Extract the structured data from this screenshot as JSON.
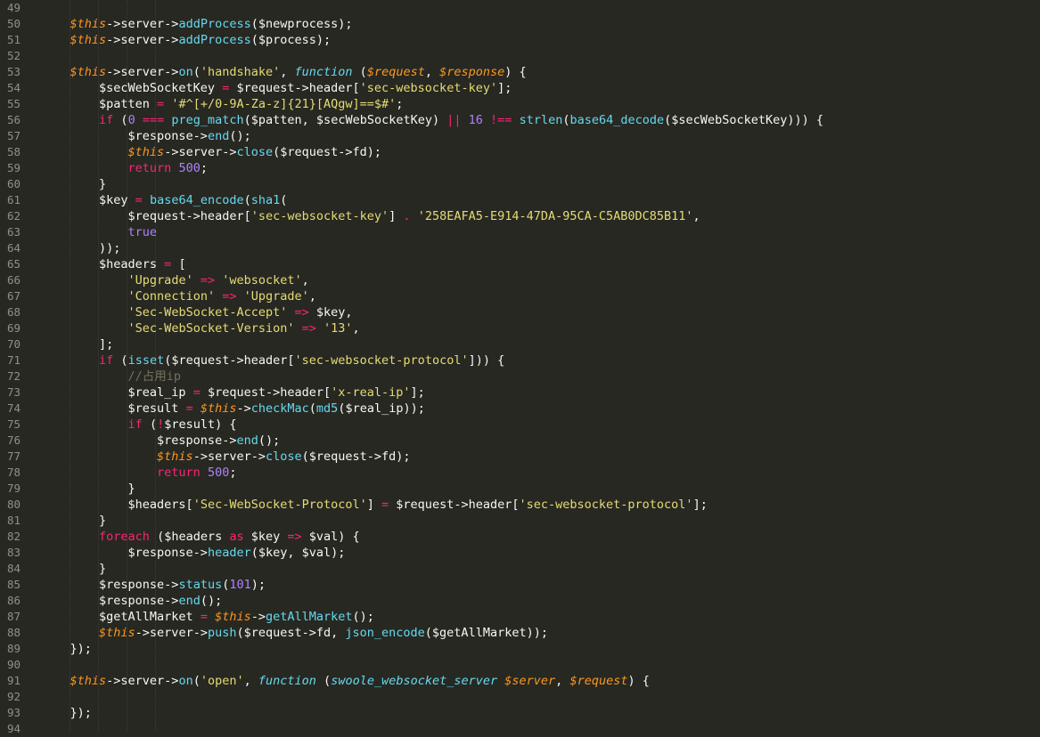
{
  "editor": {
    "theme_colors": {
      "background": "#272822",
      "text": "#f8f8f2",
      "line_number": "#90908a",
      "variable_this": "#fd971f",
      "function": "#66d9ef",
      "keyword": "#f92672",
      "string": "#e6db74",
      "number": "#ae81ff",
      "comment": "#75715e"
    },
    "lines": [
      {
        "n": "49",
        "tokens": []
      },
      {
        "n": "50",
        "tokens": [
          [
            "    ",
            "v"
          ],
          [
            "$this",
            "t"
          ],
          [
            "->server->",
            "v"
          ],
          [
            "addProcess",
            "f"
          ],
          [
            "($newprocess);",
            "v"
          ]
        ]
      },
      {
        "n": "51",
        "tokens": [
          [
            "    ",
            "v"
          ],
          [
            "$this",
            "t"
          ],
          [
            "->server->",
            "v"
          ],
          [
            "addProcess",
            "f"
          ],
          [
            "($process);",
            "v"
          ]
        ]
      },
      {
        "n": "52",
        "tokens": []
      },
      {
        "n": "53",
        "tokens": [
          [
            "    ",
            "v"
          ],
          [
            "$this",
            "t"
          ],
          [
            "->server->",
            "v"
          ],
          [
            "on",
            "f"
          ],
          [
            "(",
            "v"
          ],
          [
            "'handshake'",
            "s"
          ],
          [
            ", ",
            "v"
          ],
          [
            "function",
            "it"
          ],
          [
            " (",
            "v"
          ],
          [
            "$request",
            "t"
          ],
          [
            ", ",
            "v"
          ],
          [
            "$response",
            "t"
          ],
          [
            ") {",
            "v"
          ]
        ]
      },
      {
        "n": "54",
        "tokens": [
          [
            "        $secWebSocketKey ",
            "v"
          ],
          [
            "=",
            "k"
          ],
          [
            " $request->header[",
            "v"
          ],
          [
            "'sec-websocket-key'",
            "s"
          ],
          [
            "];",
            "v"
          ]
        ]
      },
      {
        "n": "55",
        "tokens": [
          [
            "        $patten ",
            "v"
          ],
          [
            "=",
            "k"
          ],
          [
            " ",
            "v"
          ],
          [
            "'#^[+/0-9A-Za-z]{21}[AQgw]==$#'",
            "s"
          ],
          [
            ";",
            "v"
          ]
        ]
      },
      {
        "n": "56",
        "tokens": [
          [
            "        ",
            "v"
          ],
          [
            "if",
            "k"
          ],
          [
            " (",
            "v"
          ],
          [
            "0",
            "n"
          ],
          [
            " ",
            "v"
          ],
          [
            "===",
            "k"
          ],
          [
            " ",
            "v"
          ],
          [
            "preg_match",
            "f"
          ],
          [
            "($patten, $secWebSocketKey) ",
            "v"
          ],
          [
            "||",
            "k"
          ],
          [
            " ",
            "v"
          ],
          [
            "16",
            "n"
          ],
          [
            " ",
            "v"
          ],
          [
            "!==",
            "k"
          ],
          [
            " ",
            "v"
          ],
          [
            "strlen",
            "f"
          ],
          [
            "(",
            "v"
          ],
          [
            "base64_decode",
            "f"
          ],
          [
            "($secWebSocketKey))) {",
            "v"
          ]
        ]
      },
      {
        "n": "57",
        "tokens": [
          [
            "            $response->",
            "v"
          ],
          [
            "end",
            "f"
          ],
          [
            "();",
            "v"
          ]
        ]
      },
      {
        "n": "58",
        "tokens": [
          [
            "            ",
            "v"
          ],
          [
            "$this",
            "t"
          ],
          [
            "->server->",
            "v"
          ],
          [
            "close",
            "f"
          ],
          [
            "($request->fd);",
            "v"
          ]
        ]
      },
      {
        "n": "59",
        "tokens": [
          [
            "            ",
            "v"
          ],
          [
            "return",
            "k"
          ],
          [
            " ",
            "v"
          ],
          [
            "500",
            "n"
          ],
          [
            ";",
            "v"
          ]
        ]
      },
      {
        "n": "60",
        "tokens": [
          [
            "        }",
            "v"
          ]
        ]
      },
      {
        "n": "61",
        "tokens": [
          [
            "        $key ",
            "v"
          ],
          [
            "=",
            "k"
          ],
          [
            " ",
            "v"
          ],
          [
            "base64_encode",
            "f"
          ],
          [
            "(",
            "v"
          ],
          [
            "sha1",
            "f"
          ],
          [
            "(",
            "v"
          ]
        ]
      },
      {
        "n": "62",
        "tokens": [
          [
            "            $request->header[",
            "v"
          ],
          [
            "'sec-websocket-key'",
            "s"
          ],
          [
            "] ",
            "v"
          ],
          [
            ".",
            "k"
          ],
          [
            " ",
            "v"
          ],
          [
            "'258EAFA5-E914-47DA-95CA-C5AB0DC85B11'",
            "s"
          ],
          [
            ",",
            "v"
          ]
        ]
      },
      {
        "n": "63",
        "tokens": [
          [
            "            ",
            "v"
          ],
          [
            "true",
            "n"
          ]
        ]
      },
      {
        "n": "64",
        "tokens": [
          [
            "        ));",
            "v"
          ]
        ]
      },
      {
        "n": "65",
        "tokens": [
          [
            "        $headers ",
            "v"
          ],
          [
            "=",
            "k"
          ],
          [
            " [",
            "v"
          ]
        ]
      },
      {
        "n": "66",
        "tokens": [
          [
            "            ",
            "v"
          ],
          [
            "'Upgrade'",
            "s"
          ],
          [
            " ",
            "v"
          ],
          [
            "=>",
            "k"
          ],
          [
            " ",
            "v"
          ],
          [
            "'websocket'",
            "s"
          ],
          [
            ",",
            "v"
          ]
        ]
      },
      {
        "n": "67",
        "tokens": [
          [
            "            ",
            "v"
          ],
          [
            "'Connection'",
            "s"
          ],
          [
            " ",
            "v"
          ],
          [
            "=>",
            "k"
          ],
          [
            " ",
            "v"
          ],
          [
            "'Upgrade'",
            "s"
          ],
          [
            ",",
            "v"
          ]
        ]
      },
      {
        "n": "68",
        "tokens": [
          [
            "            ",
            "v"
          ],
          [
            "'Sec-WebSocket-Accept'",
            "s"
          ],
          [
            " ",
            "v"
          ],
          [
            "=>",
            "k"
          ],
          [
            " $key,",
            "v"
          ]
        ]
      },
      {
        "n": "69",
        "tokens": [
          [
            "            ",
            "v"
          ],
          [
            "'Sec-WebSocket-Version'",
            "s"
          ],
          [
            " ",
            "v"
          ],
          [
            "=>",
            "k"
          ],
          [
            " ",
            "v"
          ],
          [
            "'13'",
            "s"
          ],
          [
            ",",
            "v"
          ]
        ]
      },
      {
        "n": "70",
        "tokens": [
          [
            "        ];",
            "v"
          ]
        ]
      },
      {
        "n": "71",
        "tokens": [
          [
            "        ",
            "v"
          ],
          [
            "if",
            "k"
          ],
          [
            " (",
            "v"
          ],
          [
            "isset",
            "f"
          ],
          [
            "($request->header[",
            "v"
          ],
          [
            "'sec-websocket-protocol'",
            "s"
          ],
          [
            "])) {",
            "v"
          ]
        ]
      },
      {
        "n": "72",
        "tokens": [
          [
            "            ",
            "v"
          ],
          [
            "//占用ip",
            "c"
          ]
        ]
      },
      {
        "n": "73",
        "tokens": [
          [
            "            $real_ip ",
            "v"
          ],
          [
            "=",
            "k"
          ],
          [
            " $request->header[",
            "v"
          ],
          [
            "'x-real-ip'",
            "s"
          ],
          [
            "];",
            "v"
          ]
        ]
      },
      {
        "n": "74",
        "tokens": [
          [
            "            $result ",
            "v"
          ],
          [
            "=",
            "k"
          ],
          [
            " ",
            "v"
          ],
          [
            "$this",
            "t"
          ],
          [
            "->",
            "v"
          ],
          [
            "checkMac",
            "f"
          ],
          [
            "(",
            "v"
          ],
          [
            "md5",
            "f"
          ],
          [
            "($real_ip));",
            "v"
          ]
        ]
      },
      {
        "n": "75",
        "tokens": [
          [
            "            ",
            "v"
          ],
          [
            "if",
            "k"
          ],
          [
            " (",
            "v"
          ],
          [
            "!",
            "k"
          ],
          [
            "$result) {",
            "v"
          ]
        ]
      },
      {
        "n": "76",
        "tokens": [
          [
            "                $response->",
            "v"
          ],
          [
            "end",
            "f"
          ],
          [
            "();",
            "v"
          ]
        ]
      },
      {
        "n": "77",
        "tokens": [
          [
            "                ",
            "v"
          ],
          [
            "$this",
            "t"
          ],
          [
            "->server->",
            "v"
          ],
          [
            "close",
            "f"
          ],
          [
            "($request->fd);",
            "v"
          ]
        ]
      },
      {
        "n": "78",
        "tokens": [
          [
            "                ",
            "v"
          ],
          [
            "return",
            "k"
          ],
          [
            " ",
            "v"
          ],
          [
            "500",
            "n"
          ],
          [
            ";",
            "v"
          ]
        ]
      },
      {
        "n": "79",
        "tokens": [
          [
            "            }",
            "v"
          ]
        ]
      },
      {
        "n": "80",
        "tokens": [
          [
            "            $headers[",
            "v"
          ],
          [
            "'Sec-WebSocket-Protocol'",
            "s"
          ],
          [
            "] ",
            "v"
          ],
          [
            "=",
            "k"
          ],
          [
            " $request->header[",
            "v"
          ],
          [
            "'sec-websocket-protocol'",
            "s"
          ],
          [
            "];",
            "v"
          ]
        ]
      },
      {
        "n": "81",
        "tokens": [
          [
            "        }",
            "v"
          ]
        ]
      },
      {
        "n": "82",
        "tokens": [
          [
            "        ",
            "v"
          ],
          [
            "foreach",
            "k"
          ],
          [
            " ($headers ",
            "v"
          ],
          [
            "as",
            "k"
          ],
          [
            " $key ",
            "v"
          ],
          [
            "=>",
            "k"
          ],
          [
            " $val) {",
            "v"
          ]
        ]
      },
      {
        "n": "83",
        "tokens": [
          [
            "            $response->",
            "v"
          ],
          [
            "header",
            "f"
          ],
          [
            "($key, $val);",
            "v"
          ]
        ]
      },
      {
        "n": "84",
        "tokens": [
          [
            "        }",
            "v"
          ]
        ]
      },
      {
        "n": "85",
        "tokens": [
          [
            "        $response->",
            "v"
          ],
          [
            "status",
            "f"
          ],
          [
            "(",
            "v"
          ],
          [
            "101",
            "n"
          ],
          [
            ");",
            "v"
          ]
        ]
      },
      {
        "n": "86",
        "tokens": [
          [
            "        $response->",
            "v"
          ],
          [
            "end",
            "f"
          ],
          [
            "();",
            "v"
          ]
        ]
      },
      {
        "n": "87",
        "tokens": [
          [
            "        $getAllMarket ",
            "v"
          ],
          [
            "=",
            "k"
          ],
          [
            " ",
            "v"
          ],
          [
            "$this",
            "t"
          ],
          [
            "->",
            "v"
          ],
          [
            "getAllMarket",
            "f"
          ],
          [
            "();",
            "v"
          ]
        ]
      },
      {
        "n": "88",
        "tokens": [
          [
            "        ",
            "v"
          ],
          [
            "$this",
            "t"
          ],
          [
            "->server->",
            "v"
          ],
          [
            "push",
            "f"
          ],
          [
            "($request->fd, ",
            "v"
          ],
          [
            "json_encode",
            "f"
          ],
          [
            "($getAllMarket));",
            "v"
          ]
        ]
      },
      {
        "n": "89",
        "tokens": [
          [
            "    });",
            "v"
          ]
        ]
      },
      {
        "n": "90",
        "tokens": []
      },
      {
        "n": "91",
        "tokens": [
          [
            "    ",
            "v"
          ],
          [
            "$this",
            "t"
          ],
          [
            "->server->",
            "v"
          ],
          [
            "on",
            "f"
          ],
          [
            "(",
            "v"
          ],
          [
            "'open'",
            "s"
          ],
          [
            ", ",
            "v"
          ],
          [
            "function",
            "it"
          ],
          [
            " (",
            "v"
          ],
          [
            "swoole_websocket_server",
            "it"
          ],
          [
            " ",
            "v"
          ],
          [
            "$server",
            "t"
          ],
          [
            ", ",
            "v"
          ],
          [
            "$request",
            "t"
          ],
          [
            ") {",
            "v"
          ]
        ]
      },
      {
        "n": "92",
        "tokens": []
      },
      {
        "n": "93",
        "tokens": [
          [
            "    });",
            "v"
          ]
        ]
      },
      {
        "n": "94",
        "tokens": []
      }
    ]
  }
}
